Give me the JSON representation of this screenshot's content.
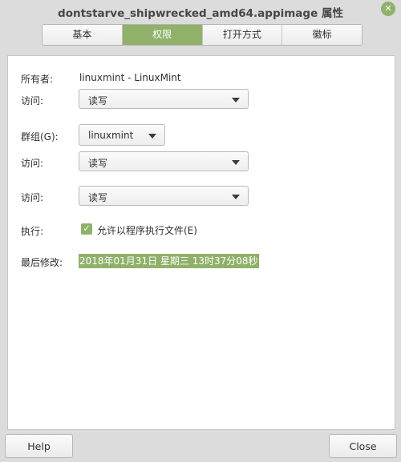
{
  "window": {
    "title": "dontstarve_shipwrecked_amd64.appimage 属性",
    "close_glyph": "✕"
  },
  "tabs": [
    {
      "label": "基本",
      "active": false
    },
    {
      "label": "权限",
      "active": true
    },
    {
      "label": "打开方式",
      "active": false
    },
    {
      "label": "徽标",
      "active": false
    }
  ],
  "permissions": {
    "owner_label": "所有者:",
    "owner_value": "linuxmint - LinuxMint",
    "owner_access_label": "访问:",
    "owner_access_value": "读写",
    "group_label": "群组(G):",
    "group_value": "linuxmint",
    "group_access_label": "访问:",
    "group_access_value": "读写",
    "other_access_label": "访问:",
    "other_access_value": "读写",
    "execute_label": "执行:",
    "execute_checkbox_label": "允许以程序执行文件(E)",
    "execute_checked": true,
    "modified_label": "最后修改:",
    "modified_value": "2018年01月31日 星期三 13时37分08秒"
  },
  "footer": {
    "help_label": "Help",
    "close_label": "Close"
  },
  "colors": {
    "accent": "#8fb16a",
    "window_bg": "#dcdcdc",
    "panel_bg": "#ffffff"
  }
}
